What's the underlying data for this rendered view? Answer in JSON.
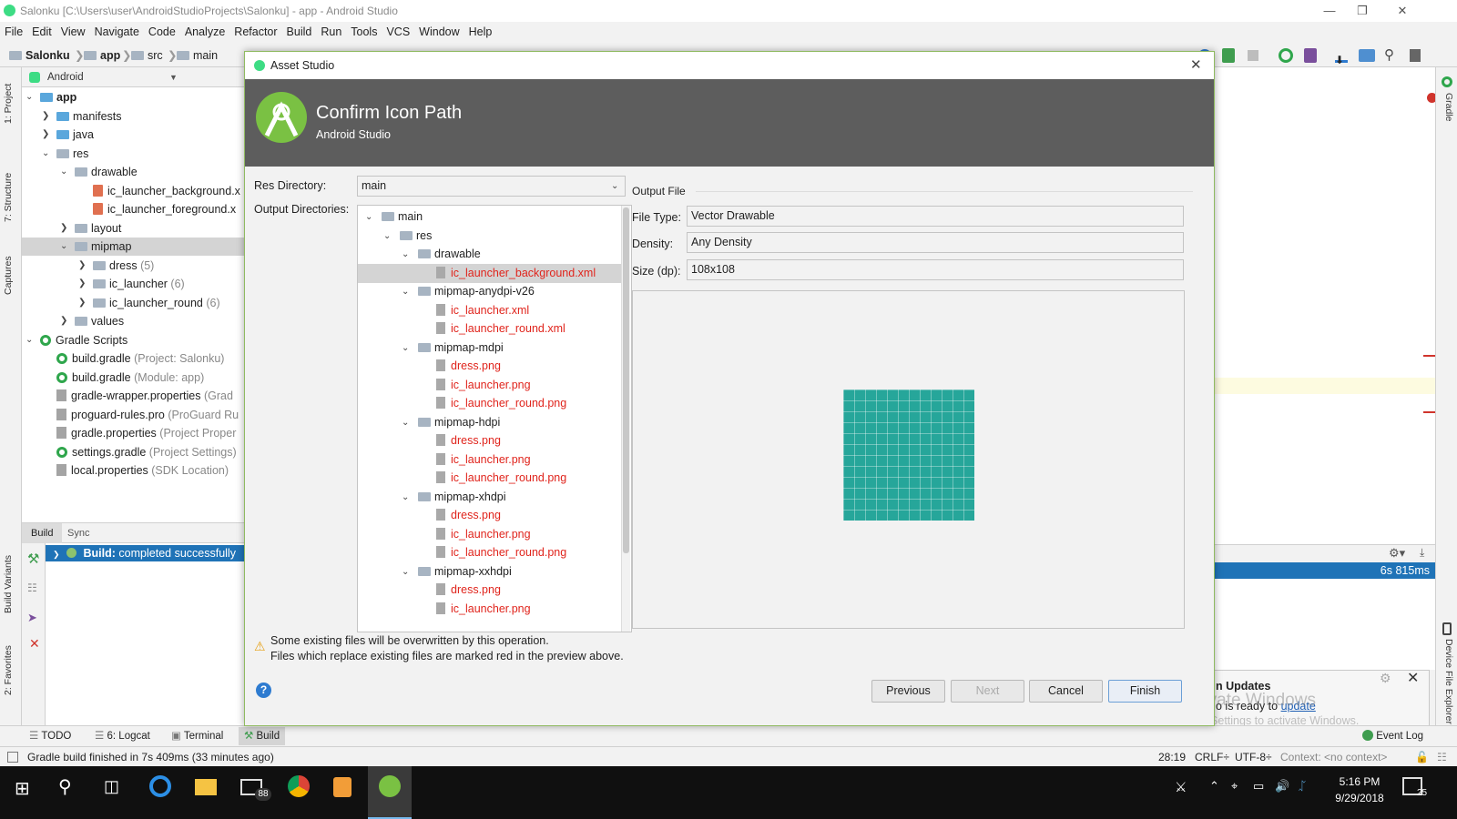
{
  "window": {
    "title": "Salonku [C:\\Users\\user\\AndroidStudioProjects\\Salonku] - app - Android Studio"
  },
  "menu": [
    "File",
    "Edit",
    "View",
    "Navigate",
    "Code",
    "Analyze",
    "Refactor",
    "Build",
    "Run",
    "Tools",
    "VCS",
    "Window",
    "Help"
  ],
  "breadcrumb": [
    "Salonku",
    "app",
    "src",
    "main"
  ],
  "project_panel": {
    "header": "Android",
    "tree": [
      {
        "label": "app",
        "extra": "",
        "level": 0,
        "kind": "module",
        "chev": "v"
      },
      {
        "label": "manifests",
        "extra": "",
        "level": 1,
        "kind": "folder-blue",
        "chev": ">"
      },
      {
        "label": "java",
        "extra": "",
        "level": 1,
        "kind": "folder-blue",
        "chev": ">"
      },
      {
        "label": "res",
        "extra": "",
        "level": 1,
        "kind": "folder",
        "chev": "v"
      },
      {
        "label": "drawable",
        "extra": "",
        "level": 2,
        "kind": "folder",
        "chev": "v"
      },
      {
        "label": "ic_launcher_background.x",
        "extra": "",
        "level": 3,
        "kind": "xml",
        "chev": ""
      },
      {
        "label": "ic_launcher_foreground.x",
        "extra": "",
        "level": 3,
        "kind": "xml",
        "chev": ""
      },
      {
        "label": "layout",
        "extra": "",
        "level": 2,
        "kind": "folder",
        "chev": ">"
      },
      {
        "label": "mipmap",
        "extra": "",
        "level": 2,
        "kind": "folder",
        "chev": "v",
        "selected": true
      },
      {
        "label": "dress",
        "extra": "(5)",
        "level": 3,
        "kind": "folder",
        "chev": ">"
      },
      {
        "label": "ic_launcher",
        "extra": "(6)",
        "level": 3,
        "kind": "folder",
        "chev": ">"
      },
      {
        "label": "ic_launcher_round",
        "extra": "(6)",
        "level": 3,
        "kind": "folder",
        "chev": ">"
      },
      {
        "label": "values",
        "extra": "",
        "level": 2,
        "kind": "folder",
        "chev": ">"
      },
      {
        "label": "Gradle Scripts",
        "extra": "",
        "level": 0,
        "kind": "gradle",
        "chev": "v"
      },
      {
        "label": "build.gradle",
        "extra": "(Project: Salonku)",
        "level": 1,
        "kind": "gradle",
        "chev": ""
      },
      {
        "label": "build.gradle",
        "extra": "(Module: app)",
        "level": 1,
        "kind": "gradle",
        "chev": ""
      },
      {
        "label": "gradle-wrapper.properties",
        "extra": "(Grad",
        "level": 1,
        "kind": "props",
        "chev": ""
      },
      {
        "label": "proguard-rules.pro",
        "extra": "(ProGuard Ru",
        "level": 1,
        "kind": "props",
        "chev": ""
      },
      {
        "label": "gradle.properties",
        "extra": "(Project Proper",
        "level": 1,
        "kind": "props",
        "chev": ""
      },
      {
        "label": "settings.gradle",
        "extra": "(Project Settings)",
        "level": 1,
        "kind": "gradle",
        "chev": ""
      },
      {
        "label": "local.properties",
        "extra": "(SDK Location)",
        "level": 1,
        "kind": "props",
        "chev": ""
      }
    ]
  },
  "left_tabs": [
    "1: Project",
    "7: Structure",
    "Captures",
    "Build Variants",
    "2: Favorites"
  ],
  "right_tabs": [
    "Gradle",
    "Device File Explorer"
  ],
  "build_panel": {
    "tabs": [
      "Build",
      "Sync"
    ],
    "status_prefix": "Build:",
    "status": "completed successfully",
    "time": "6s 815ms"
  },
  "dialog": {
    "title": "Asset Studio",
    "heading": "Confirm Icon Path",
    "subheading": "Android Studio",
    "res_dir_label": "Res Directory:",
    "res_dir_value": "main",
    "output_dirs_label": "Output Directories:",
    "tree": [
      {
        "label": "main",
        "level": 0,
        "chev": "v",
        "type": "folder"
      },
      {
        "label": "res",
        "level": 1,
        "chev": "v",
        "type": "folder"
      },
      {
        "label": "drawable",
        "level": 2,
        "chev": "v",
        "type": "folder"
      },
      {
        "label": "ic_launcher_background.xml",
        "level": 3,
        "chev": "",
        "type": "file",
        "red": true,
        "selected": true
      },
      {
        "label": "mipmap-anydpi-v26",
        "level": 2,
        "chev": "v",
        "type": "folder"
      },
      {
        "label": "ic_launcher.xml",
        "level": 3,
        "chev": "",
        "type": "file",
        "red": true
      },
      {
        "label": "ic_launcher_round.xml",
        "level": 3,
        "chev": "",
        "type": "file",
        "red": true
      },
      {
        "label": "mipmap-mdpi",
        "level": 2,
        "chev": "v",
        "type": "folder"
      },
      {
        "label": "dress.png",
        "level": 3,
        "chev": "",
        "type": "file",
        "red": true
      },
      {
        "label": "ic_launcher.png",
        "level": 3,
        "chev": "",
        "type": "file",
        "red": true
      },
      {
        "label": "ic_launcher_round.png",
        "level": 3,
        "chev": "",
        "type": "file",
        "red": true
      },
      {
        "label": "mipmap-hdpi",
        "level": 2,
        "chev": "v",
        "type": "folder"
      },
      {
        "label": "dress.png",
        "level": 3,
        "chev": "",
        "type": "file",
        "red": true
      },
      {
        "label": "ic_launcher.png",
        "level": 3,
        "chev": "",
        "type": "file",
        "red": true
      },
      {
        "label": "ic_launcher_round.png",
        "level": 3,
        "chev": "",
        "type": "file",
        "red": true
      },
      {
        "label": "mipmap-xhdpi",
        "level": 2,
        "chev": "v",
        "type": "folder"
      },
      {
        "label": "dress.png",
        "level": 3,
        "chev": "",
        "type": "file",
        "red": true
      },
      {
        "label": "ic_launcher.png",
        "level": 3,
        "chev": "",
        "type": "file",
        "red": true
      },
      {
        "label": "ic_launcher_round.png",
        "level": 3,
        "chev": "",
        "type": "file",
        "red": true
      },
      {
        "label": "mipmap-xxhdpi",
        "level": 2,
        "chev": "v",
        "type": "folder"
      },
      {
        "label": "dress.png",
        "level": 3,
        "chev": "",
        "type": "file",
        "red": true
      },
      {
        "label": "ic_launcher.png",
        "level": 3,
        "chev": "",
        "type": "file",
        "red": true
      }
    ],
    "output_file_label": "Output File",
    "file_type_label": "File Type:",
    "file_type_value": "Vector Drawable",
    "density_label": "Density:",
    "density_value": "Any Density",
    "size_label": "Size (dp):",
    "size_value": "108x108",
    "warning_line1": "Some existing files will be overwritten by this operation.",
    "warning_line2": "Files which replace existing files are marked red in the preview above.",
    "buttons": {
      "previous": "Previous",
      "next": "Next",
      "cancel": "Cancel",
      "finish": "Finish"
    }
  },
  "notification": {
    "title": "n Updates",
    "text_prefix": "o is ready to",
    "link": "update",
    "watermark1": "Activate Windows",
    "watermark2": "Go to Settings to activate Windows."
  },
  "bottom_tabs": [
    "TODO",
    "6: Logcat",
    "Terminal",
    "Build"
  ],
  "event_log": "Event Log",
  "status": {
    "message": "Gradle build finished in 7s 409ms (33 minutes ago)",
    "position": "28:19",
    "line_sep": "CRLF÷",
    "encoding": "UTF-8÷",
    "context": "Context: <no context>"
  },
  "taskbar": {
    "mail_badge": "88",
    "time": "5:16 PM",
    "date": "9/29/2018",
    "notif_count": "25"
  },
  "colors": {
    "accent_blue": "#1f73b7",
    "banner": "#5d5d5d",
    "red_file": "#e0241c",
    "android_green": "#3ddc84",
    "icon_teal": "#26a69a"
  }
}
